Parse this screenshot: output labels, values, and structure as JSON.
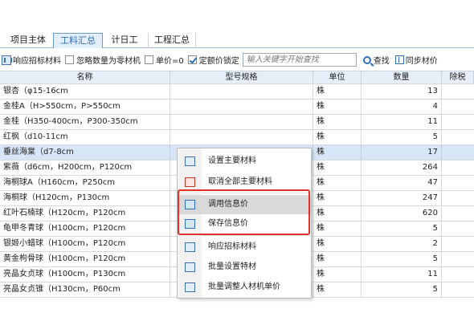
{
  "tabs": [
    {
      "label": "项目主体"
    },
    {
      "label": "工料汇总"
    },
    {
      "label": "计日工"
    },
    {
      "label": "工程汇总"
    }
  ],
  "toolbar": {
    "respond_label": "响应招标材料",
    "ignore_zero_label": "忽略数量为零材机",
    "unit_price_zero_label": "单价=0",
    "fixed_price_lock_label": "定额价锁定",
    "search_placeholder": "输入关键字开始查找",
    "find_label": "查找",
    "sync_label": "同步材价"
  },
  "table": {
    "headers": {
      "name": "名称",
      "spec": "型号规格",
      "unit": "单位",
      "qty": "数量",
      "tax": "除税"
    },
    "rows": [
      {
        "name": "银杏（φ15-16cm",
        "spec": "",
        "unit": "株",
        "qty": "13"
      },
      {
        "name": "金桂A（H>550cm，P>550cm",
        "spec": "",
        "unit": "株",
        "qty": "4"
      },
      {
        "name": "金桂（H350-400cm，P300-350cm",
        "spec": "",
        "unit": "株",
        "qty": "11"
      },
      {
        "name": "红枫（d10-11cm",
        "spec": "",
        "unit": "株",
        "qty": "5"
      },
      {
        "name": "垂丝海棠（d7-8cm",
        "spec": "",
        "unit": "株",
        "qty": "17"
      },
      {
        "name": "紫薇（d6cm，H200cm，P120cm",
        "spec": "",
        "unit": "株",
        "qty": "264"
      },
      {
        "name": "海桐球A（H160cm，P250cm",
        "spec": "",
        "unit": "株",
        "qty": "47"
      },
      {
        "name": "海桐球（H120cm，P130cm",
        "spec": "",
        "unit": "株",
        "qty": "247"
      },
      {
        "name": "红叶石楠球（H120cm，P120cm",
        "spec": "",
        "unit": "株",
        "qty": "620"
      },
      {
        "name": "龟甲冬青球（H100cm，P120cm",
        "spec": "",
        "unit": "株",
        "qty": "5"
      },
      {
        "name": "银姬小蜡球（H100cm，P120cm",
        "spec": "",
        "unit": "株",
        "qty": "2"
      },
      {
        "name": "黄金枸骨球（H100cm，P120cm",
        "spec": "",
        "unit": "株",
        "qty": "5"
      },
      {
        "name": "亮晶女贞球（H100cm，P130cm",
        "spec": "",
        "unit": "株",
        "qty": "11"
      },
      {
        "name": "亮晶女贞锥（H130cm，P60cm",
        "spec": "",
        "unit": "株",
        "qty": "5"
      }
    ]
  },
  "context_menu": {
    "items": [
      {
        "label": "设置主要材料",
        "icon": "set-main-material-icon"
      },
      {
        "label": "取消全部主要材料",
        "icon": "cancel-main-material-icon"
      },
      {
        "label": "调用信息价",
        "icon": "load-info-price-icon"
      },
      {
        "label": "保存信息价",
        "icon": "save-info-price-icon"
      },
      {
        "label": "响应招标材料",
        "icon": "respond-tender-icon"
      },
      {
        "label": "批量设置特材",
        "icon": "batch-special-material-icon"
      },
      {
        "label": "批量调整人材机单价",
        "icon": "batch-adjust-price-icon"
      }
    ]
  },
  "colors": {
    "accent": "#2f6fb7",
    "highlight": "#e0312b",
    "selected_row": "#d7e6f6"
  }
}
